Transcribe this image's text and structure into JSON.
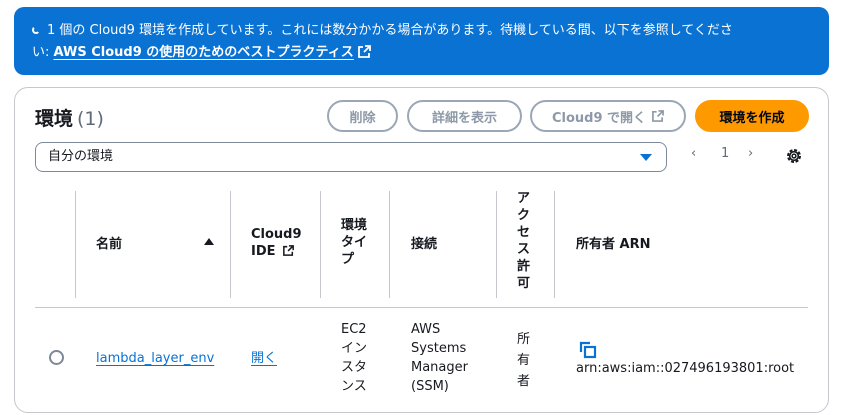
{
  "banner": {
    "message": "1 個の Cloud9 環境を作成しています。これには数分かかる場合があります。待機している間、以下を参照してくださ",
    "message_cont": "い: ",
    "link_text": "AWS Cloud9 の使用のためのベストプラクティス"
  },
  "header": {
    "title": "環境",
    "count": "(1)"
  },
  "actions": {
    "delete": "削除",
    "details": "詳細を表示",
    "open_in_cloud9": "Cloud9 で開く",
    "create": "環境を作成"
  },
  "filter": {
    "selected": "自分の環境"
  },
  "pagination": {
    "prev": "‹",
    "page": "1",
    "next": "›"
  },
  "table": {
    "columns": {
      "name": "名前",
      "ide_line1": "Cloud9",
      "ide_line2": "IDE",
      "env_type": [
        "環境",
        "タイ",
        "プ"
      ],
      "connection": "接続",
      "access": [
        "ア",
        "ク",
        "セ",
        "ス",
        "許",
        "可"
      ],
      "owner_arn": "所有者 ARN"
    },
    "rows": [
      {
        "name": "lambda_layer_env",
        "ide": "開く",
        "env_type": [
          "EC2",
          "イン",
          "スタ",
          "ンス"
        ],
        "connection": [
          "AWS",
          "Systems",
          "Manager",
          "(SSM)"
        ],
        "access": [
          "所",
          "有",
          "者"
        ],
        "owner_arn": "arn:aws:iam::027496193801:root"
      }
    ]
  },
  "colors": {
    "banner_bg": "#0972d3",
    "primary_button": "#ff9900",
    "link": "#0972d3",
    "border": "#c6c6cd"
  }
}
